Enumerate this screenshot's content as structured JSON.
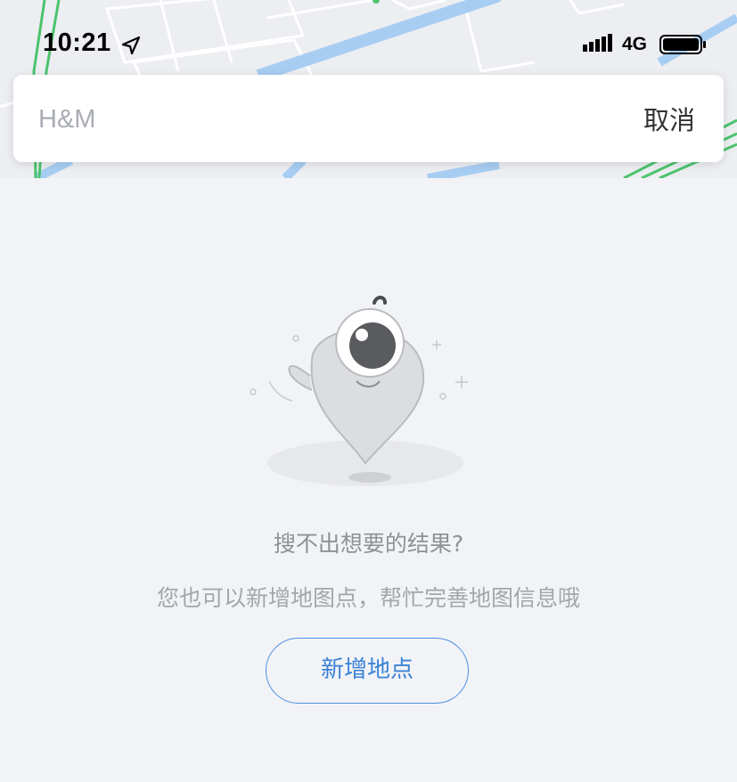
{
  "status_bar": {
    "time": "10:21",
    "network": "4G"
  },
  "search": {
    "placeholder": "H&M",
    "value": "",
    "cancel_label": "取消"
  },
  "empty_state": {
    "title": "搜不出想要的结果?",
    "subtitle": "您也可以新增地图点，帮忙完善地图信息哦",
    "button_label": "新增地点"
  },
  "colors": {
    "accent": "#4a90e2",
    "background": "#f2f3f7",
    "map_road_blue": "#a7cdf2",
    "map_route_green": "#4cc36c"
  }
}
